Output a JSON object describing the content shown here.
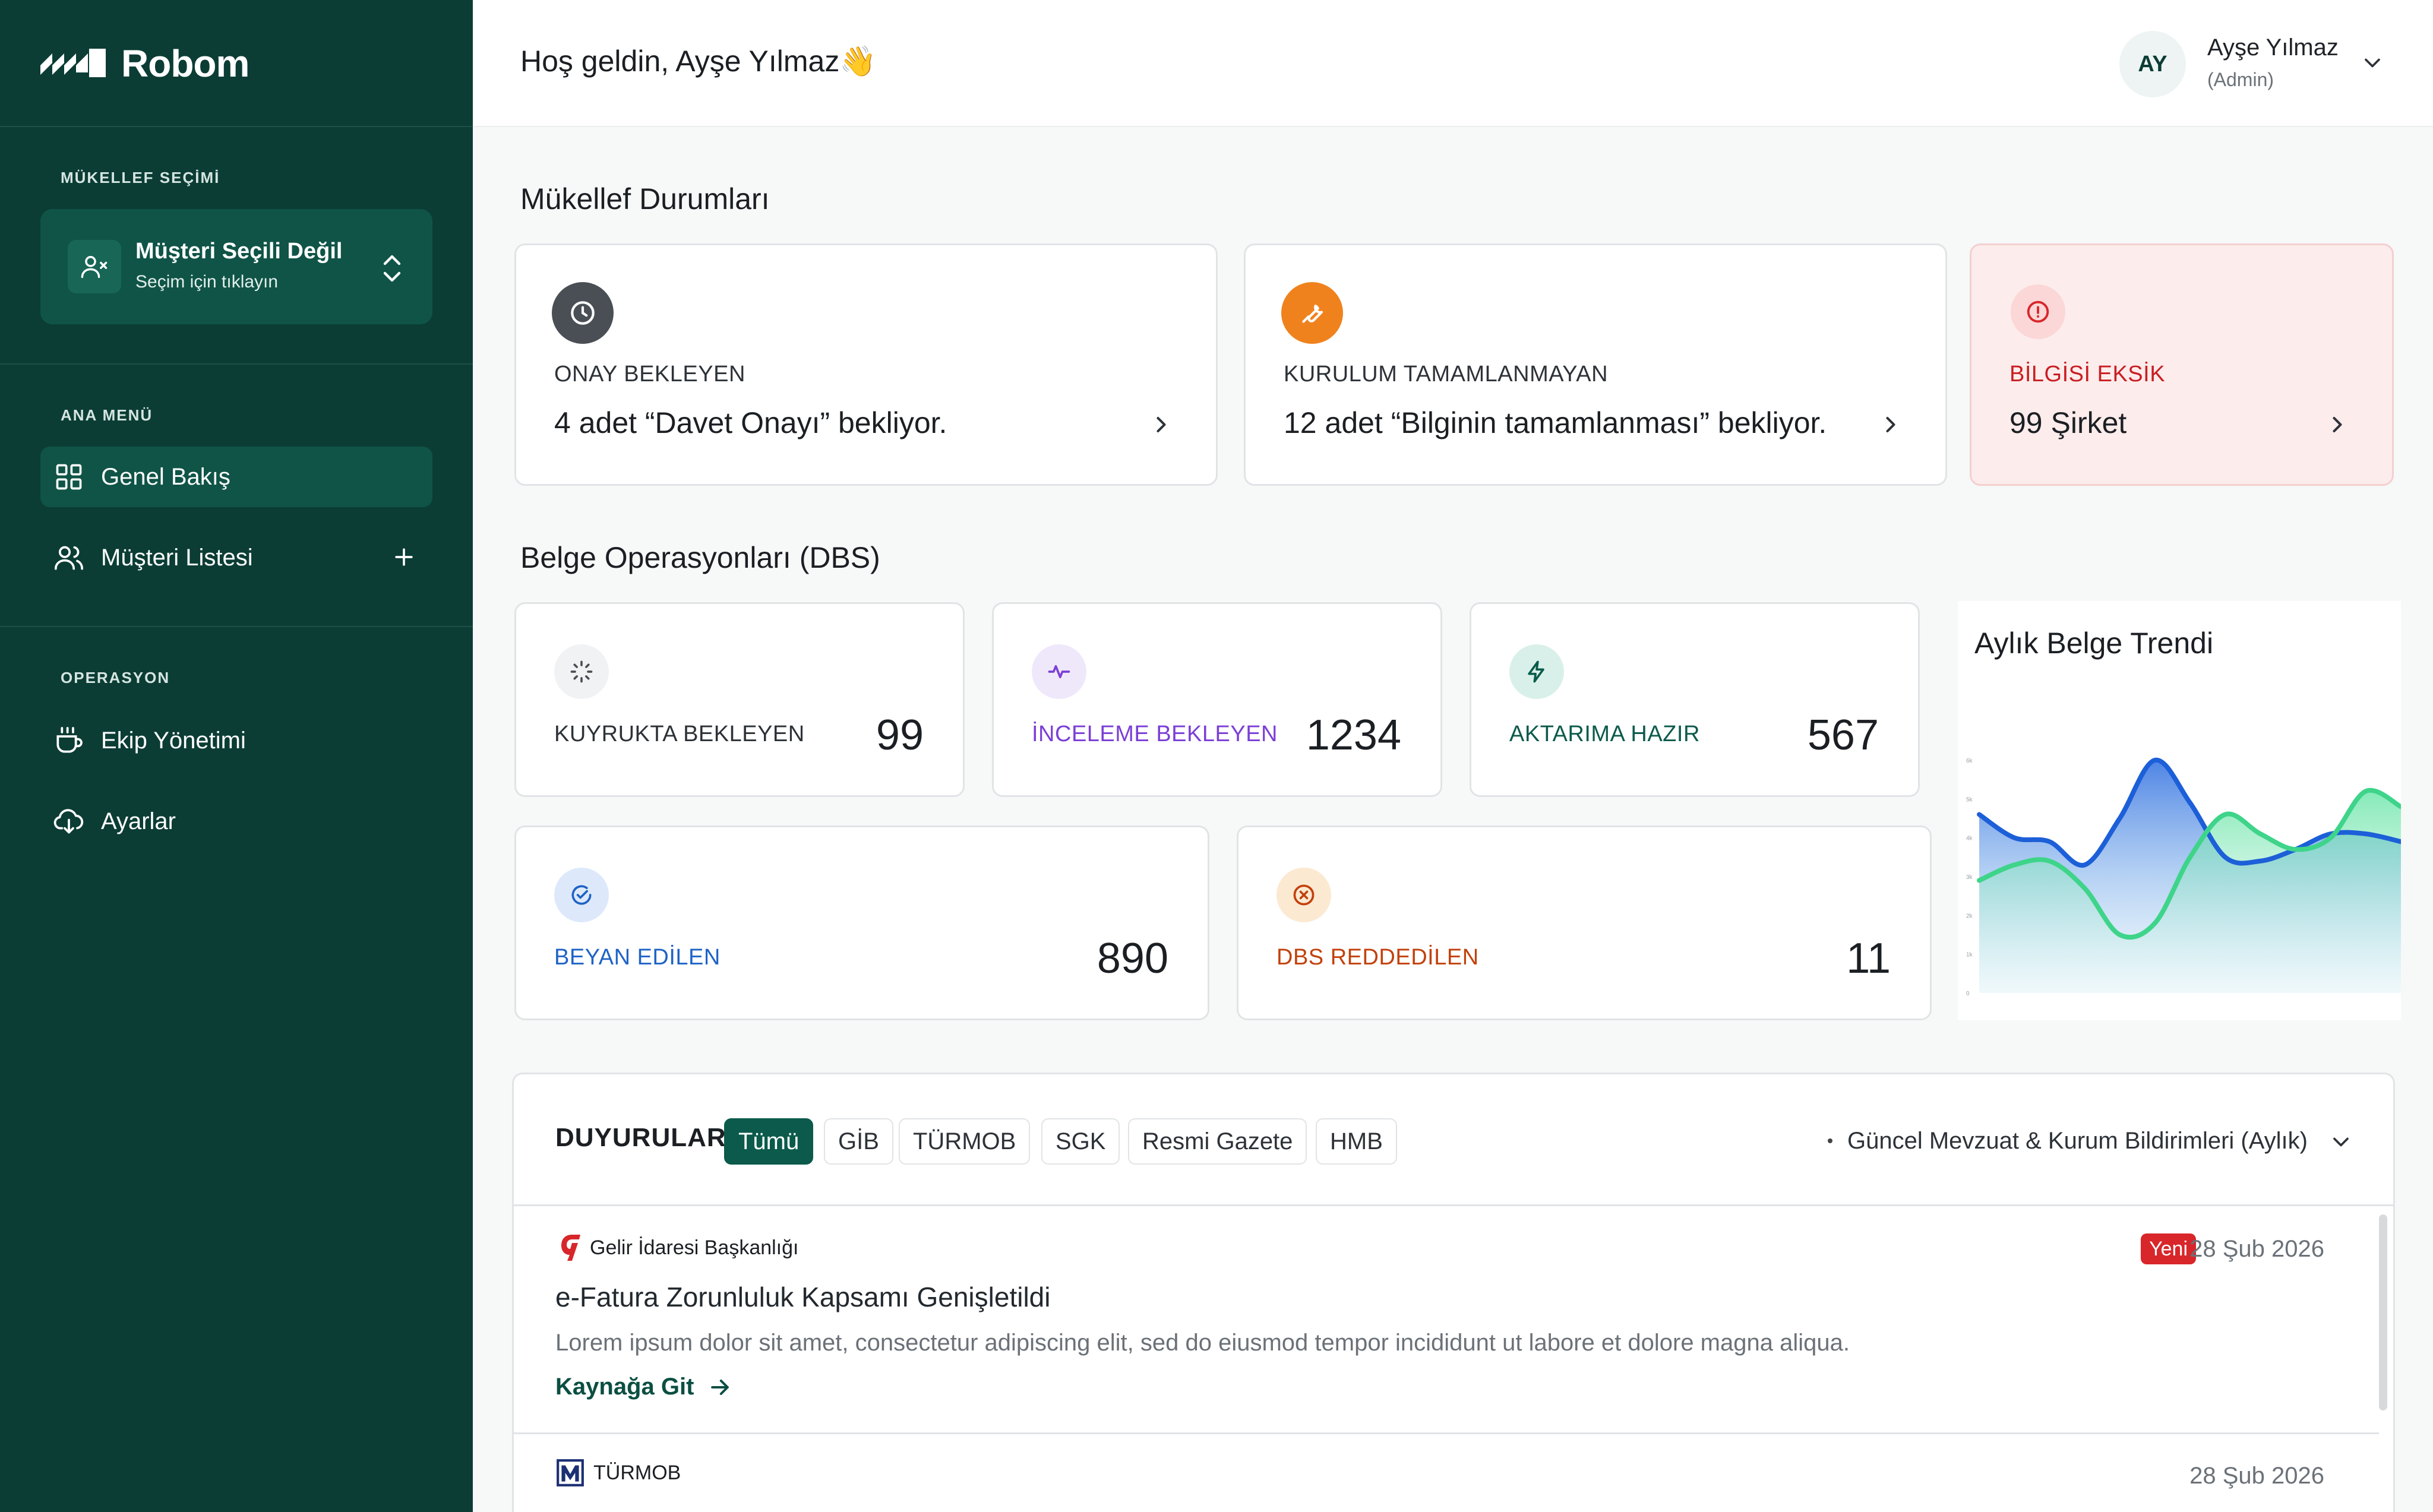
{
  "sidebar": {
    "logo": "Robom",
    "client_section": "MÜKELLEF SEÇİMİ",
    "client_title": "Müşteri Seçili Değil",
    "client_sub": "Seçim için tıklayın",
    "main_section": "ANA MENÜ",
    "main_items": [
      {
        "label": "Genel Bakış",
        "icon": "grid-icon",
        "active": true
      },
      {
        "label": "Müşteri Listesi",
        "icon": "users-icon",
        "active": false
      }
    ],
    "ops_section": "OPERASYON",
    "ops_items": [
      {
        "label": "Ekip Yönetimi",
        "icon": "coffee-cup-icon"
      },
      {
        "label": "Ayarlar",
        "icon": "cloud-download-icon"
      }
    ]
  },
  "header": {
    "greeting": "Hoş geldin, Ayşe Yılmaz👋",
    "avatar_initials": "AY",
    "user_name": "Ayşe Yılmaz",
    "user_role": "(Admin)"
  },
  "status": {
    "title": "Mükellef Durumları",
    "cards": [
      {
        "label": "ONAY BEKLEYEN",
        "text": "4 adet “Davet Onayı” bekliyor.",
        "icon": "clock-icon",
        "color": "#4a4f55"
      },
      {
        "label": "KURULUM TAMAMLANMAYAN",
        "text": "12 adet “Bilginin tamamlanması” bekliyor.",
        "icon": "wrench-icon",
        "color": "#f0821e"
      },
      {
        "label": "BİLGİSİ EKSİK",
        "text": "99 Şirket",
        "icon": "alert-circle-icon",
        "color": "#d8262a"
      }
    ]
  },
  "dbs": {
    "title": "Belge Operasyonları (DBS)",
    "cards": [
      {
        "label": "KUYRUKTA BEKLEYEN",
        "value": "99",
        "icon": "loader-icon",
        "color": "#2d3238"
      },
      {
        "label": "İNCELEME BEKLEYEN",
        "value": "1234",
        "icon": "activity-icon",
        "color": "#7b3fd6"
      },
      {
        "label": "AKTARIMA HAZIR",
        "value": "567",
        "icon": "bolt-icon",
        "color": "#0b5a4b"
      },
      {
        "label": "BEYAN EDİLEN",
        "value": "890",
        "icon": "check-circle-icon",
        "color": "#1f63c6"
      },
      {
        "label": "DBS REDDEDİLEN",
        "value": "11",
        "icon": "x-circle-icon",
        "color": "#c2410c"
      }
    ]
  },
  "trend": {
    "title": "Aylık Belge Trendi",
    "y_ticks": [
      "6k",
      "5k",
      "4k",
      "3k",
      "2k",
      "1k",
      "0"
    ]
  },
  "chart_data": {
    "type": "area",
    "title": "Aylık Belge Trendi",
    "ylim": [
      0,
      6000
    ],
    "x": [
      0,
      1,
      2,
      3,
      4,
      5,
      6,
      7,
      8,
      9,
      10,
      11,
      12
    ],
    "series": [
      {
        "values": [
          4600,
          4000,
          3900,
          3300,
          4500,
          6000,
          4900,
          3500,
          3400,
          3700,
          4100,
          4100,
          3900
        ],
        "color": "#1c5fd8"
      },
      {
        "values": [
          2900,
          3300,
          3400,
          2700,
          1500,
          1800,
          3500,
          4600,
          4100,
          3700,
          4000,
          5200,
          4800
        ],
        "color": "#3ed48a"
      }
    ]
  },
  "announcements": {
    "title": "DUYURULAR",
    "chips": [
      "Tümü",
      "GİB",
      "TÜRMOB",
      "SGK",
      "Resmi Gazete",
      "HMB"
    ],
    "filter": "Güncel Mevzuat & Kurum Bildirimleri (Aylık)",
    "items": [
      {
        "source": "Gelir İdaresi Başkanlığı",
        "badge": "Yeni",
        "date": "28 Şub 2026",
        "headline": "e-Fatura Zorunluluk Kapsamı Genişletildi",
        "body": "Lorem ipsum dolor sit amet, consectetur adipiscing elit, sed do eiusmod tempor incididunt ut labore et dolore magna aliqua.",
        "link": "Kaynağa Git"
      },
      {
        "source": "TÜRMOB",
        "date": "28 Şub 2026"
      }
    ]
  },
  "colors": {
    "sidebar": "#0b3d35",
    "accent": "#0b5a4b",
    "alert": "#d8262a"
  }
}
